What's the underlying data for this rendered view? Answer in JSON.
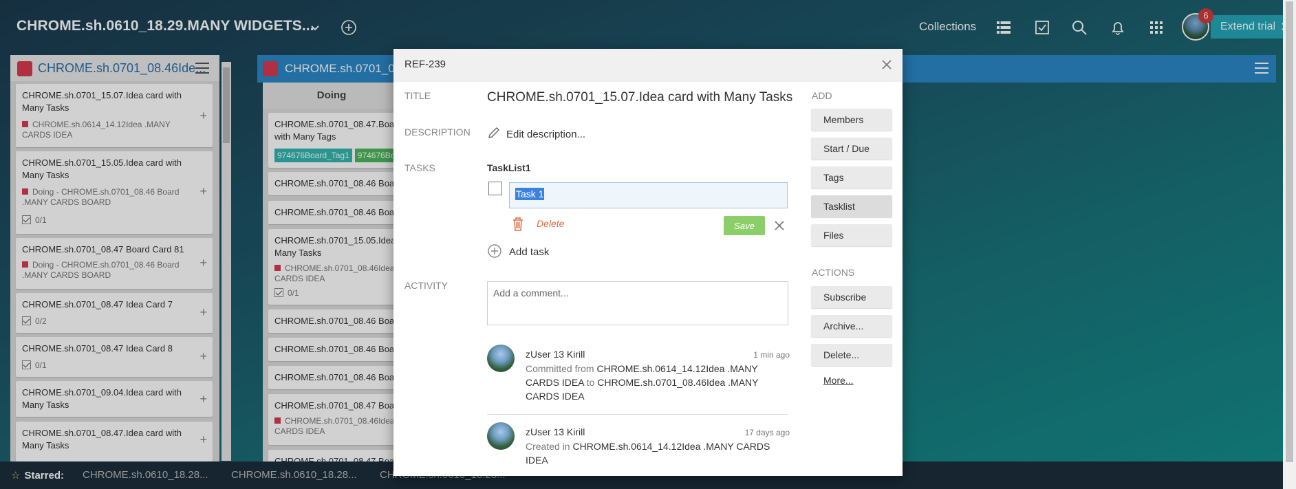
{
  "topbar": {
    "board_title": "CHROME.sh.0610_18.29.MANY WIDGETS...",
    "collections": "Collections",
    "notifications_count": "6",
    "extend_trial": "Extend trial"
  },
  "column1": {
    "title": "CHROME.sh.0701_08.46Ide...",
    "cards": [
      {
        "title": "CHROME.sh.0701_15.07.Idea card with Many Tasks",
        "sub": "CHROME.sh.0614_14.12Idea .MANY CARDS IDEA"
      },
      {
        "title": "CHROME.sh.0701_15.05.Idea card with Many Tasks",
        "sub": "Doing - CHROME.sh.0701_08.46 Board .MANY CARDS BOARD",
        "tasks": "0/1"
      },
      {
        "title": "CHROME.sh.0701_08.47 Board Card 81",
        "sub": "Doing - CHROME.sh.0701_08.46 Board .MANY CARDS BOARD"
      },
      {
        "title": "CHROME.sh.0701_08.47 Idea Card 7",
        "tasks": "0/2"
      },
      {
        "title": "CHROME.sh.0701_08.47 Idea Card 8",
        "tasks": "0/1"
      },
      {
        "title": "CHROME.sh.0701_09.04.Idea card with Many Tasks"
      },
      {
        "title": "CHROME.sh.0701_08.47.Idea card with Many Tasks"
      }
    ]
  },
  "column2": {
    "title": "CHROME.sh.0701_08",
    "list_name": "Doing",
    "cards": [
      {
        "title": "CHROME.sh.0701_08.47.Boar with Many Tags",
        "tags": [
          "974676Board_Tag1",
          "974676Bo"
        ]
      },
      {
        "title": "CHROME.sh.0701_08.46 Boar"
      },
      {
        "title": "CHROME.sh.0701_08.46 Boar"
      },
      {
        "title": "CHROME.sh.0701_15.05.Idea Many Tasks",
        "sub": "CHROME.sh.0701_08.46Idea CARDS IDEA",
        "tasks": "0/1"
      },
      {
        "title": "CHROME.sh.0701_08.46 Boar"
      },
      {
        "title": "CHROME.sh.0701_08.46 Boar"
      },
      {
        "title": "CHROME.sh.0701_08.46 Boar"
      },
      {
        "title": "CHROME.sh.0701_08.47 Boar",
        "sub": "CHROME.sh.0701_08.46Idea CARDS IDEA"
      },
      {
        "title": "CHROME.sh.0701_08.47 Boar"
      }
    ]
  },
  "bottombar": {
    "starred": "Starred:",
    "items": [
      "CHROME.sh.0610_18.28...",
      "CHROME.sh.0610_18.28...",
      "CHROME.sh.0610_18.28..."
    ]
  },
  "modal": {
    "ref": "REF-239",
    "labels": {
      "title": "TITLE",
      "description": "DESCRIPTION",
      "tasks": "TASKS",
      "activity": "ACTIVITY",
      "add": "ADD",
      "actions": "ACTIONS"
    },
    "title": "CHROME.sh.0701_15.07.Idea card with Many Tasks",
    "edit_description": "Edit description...",
    "tasklist_name": "TaskList1",
    "task_input_value": "Task 1",
    "delete_label": "Delete",
    "save_label": "Save",
    "add_task": "Add task",
    "comment_placeholder": "Add a comment...",
    "activity": [
      {
        "user": "zUser 13 Kirill",
        "time": "1 min ago",
        "text_a": "Committed from",
        "text_b": "CHROME.sh.0614_14.12Idea .MANY CARDS IDEA",
        "text_c": "to",
        "text_d": "CHROME.sh.0701_08.46Idea .MANY CARDS IDEA"
      },
      {
        "user": "zUser 13 Kirill",
        "time": "17 days ago",
        "text_a": "Created in",
        "text_b": "CHROME.sh.0614_14.12Idea .MANY CARDS IDEA"
      }
    ],
    "add_buttons": [
      "Members",
      "Start / Due",
      "Tags",
      "Tasklist",
      "Files"
    ],
    "action_buttons": [
      "Subscribe",
      "Archive...",
      "Delete..."
    ],
    "more": "More..."
  },
  "colors": {
    "accent_blue": "#2b87c7",
    "save_green": "#8ccf6a",
    "delete_orange": "#e06a40",
    "badge_red": "#d33b3b"
  }
}
